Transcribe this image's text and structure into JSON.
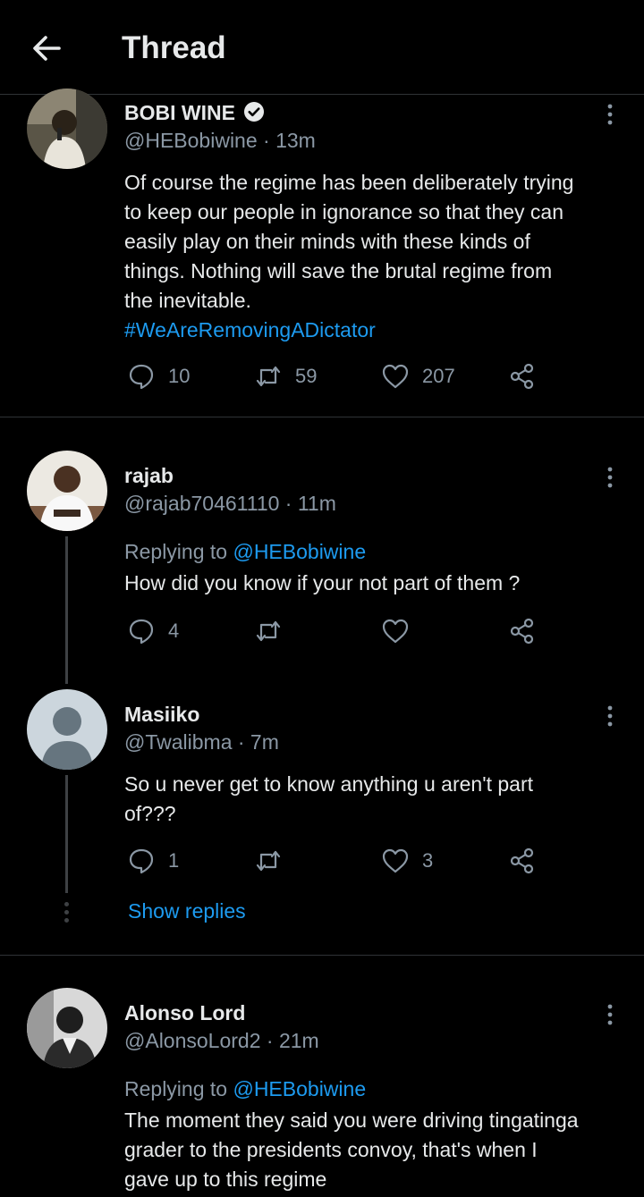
{
  "header": {
    "title": "Thread"
  },
  "tweets": [
    {
      "name": "BOBI WINE",
      "verified": true,
      "handle_time": "@HEBobiwine · 13m",
      "lines": [
        "Of course the regime has been deliberately trying",
        "to keep our people in ignorance so that they can",
        "easily play on their minds with these kinds of",
        "things. Nothing will save the brutal regime from",
        "the inevitable."
      ],
      "hashtag": "#WeAreRemovingADictator",
      "replies": "10",
      "retweets": "59",
      "likes": "207"
    },
    {
      "name": "rajab",
      "handle_time": "@rajab70461110 · 11m",
      "replying_label": "Replying to ",
      "replying_handle": "@HEBobiwine",
      "text": "How did you know if your not part of them ?",
      "replies": "4",
      "retweets": "",
      "likes": ""
    },
    {
      "name": "Masiiko",
      "handle_time": "@Twalibma · 7m",
      "lines": [
        "So u never get to know anything u aren't part",
        "of???"
      ],
      "replies": "1",
      "retweets": "",
      "likes": "3",
      "show_replies": "Show replies"
    },
    {
      "name": "Alonso Lord",
      "handle_time": "@AlonsoLord2 · 21m",
      "replying_label": "Replying to ",
      "replying_handle": "@HEBobiwine",
      "lines": [
        "The moment they said you were driving tingatinga",
        "grader to the presidents convoy, that's when I",
        "gave up to this regime"
      ]
    }
  ],
  "colors": {
    "accent": "#1d9bf0",
    "secondary_text": "#8b98a5",
    "background": "#000000"
  }
}
